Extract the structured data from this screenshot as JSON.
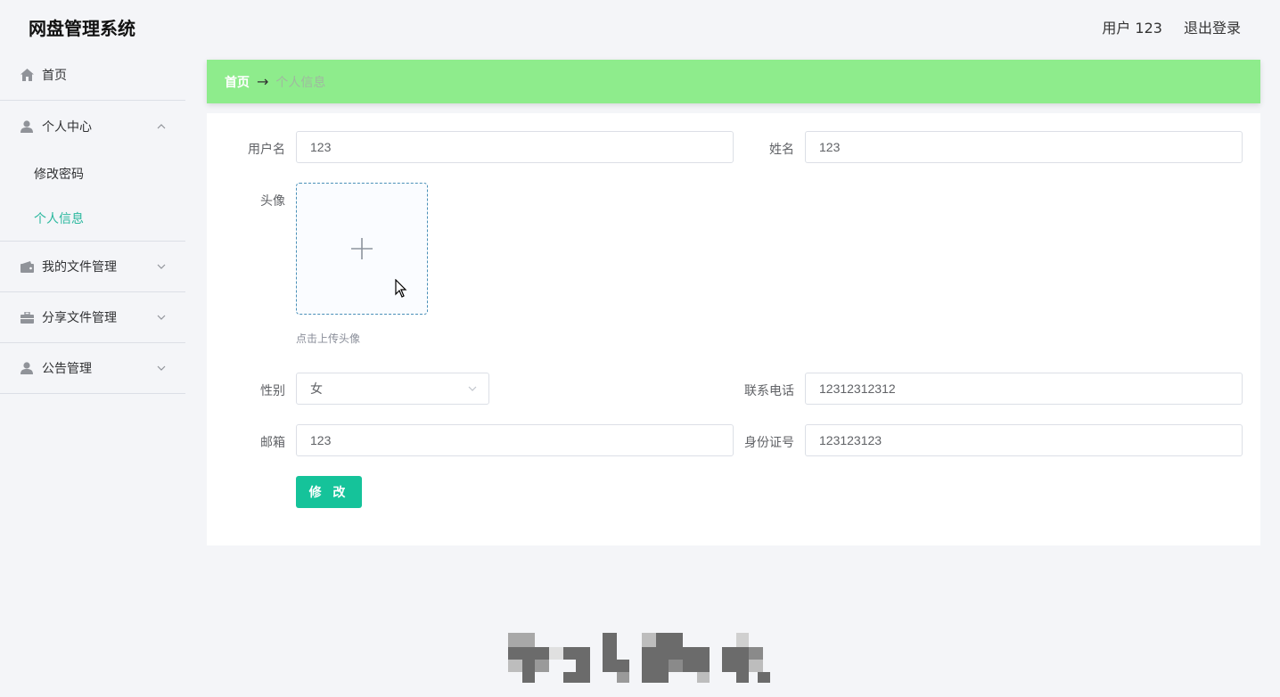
{
  "app": {
    "title": "网盘管理系统"
  },
  "header": {
    "user_label": "用户 123",
    "logout_label": "退出登录"
  },
  "sidebar": {
    "items": [
      {
        "label": "首页",
        "icon": "home-icon"
      },
      {
        "label": "个人中心",
        "icon": "user-icon",
        "expanded": true,
        "children": [
          {
            "label": "修改密码"
          },
          {
            "label": "个人信息",
            "active": true
          }
        ]
      },
      {
        "label": "我的文件管理",
        "icon": "wallet-icon"
      },
      {
        "label": "分享文件管理",
        "icon": "briefcase-icon"
      },
      {
        "label": "公告管理",
        "icon": "user-icon"
      }
    ],
    "active_color": "#2ab89e"
  },
  "breadcrumb": {
    "home": "首页",
    "separator": "→",
    "current": "个人信息"
  },
  "form": {
    "username": {
      "label": "用户名",
      "value": "123"
    },
    "name": {
      "label": "姓名",
      "value": "123"
    },
    "avatar": {
      "label": "头像",
      "tip": "点击上传头像"
    },
    "gender": {
      "label": "性别",
      "value": "女"
    },
    "phone": {
      "label": "联系电话",
      "value": "12312312312"
    },
    "email": {
      "label": "邮箱",
      "value": "123"
    },
    "id_number": {
      "label": "身份证号",
      "value": "123123123"
    },
    "submit_label": "修 改"
  },
  "colors": {
    "breadcrumb_bg": "#8eec8c",
    "primary_button": "#15c39a"
  }
}
